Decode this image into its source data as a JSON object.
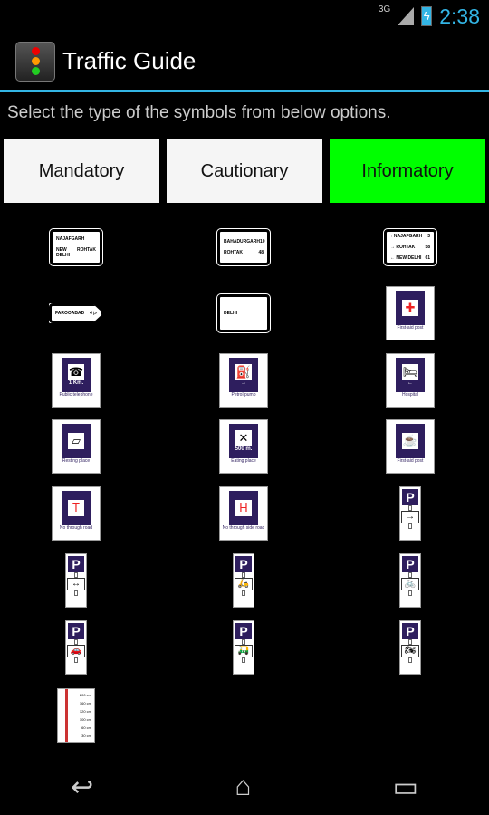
{
  "status": {
    "network": "3G",
    "time": "2:38"
  },
  "app": {
    "title": "Traffic Guide"
  },
  "prompt": "Select the type of the symbols from below options.",
  "categories": [
    {
      "label": "Mandatory",
      "selected": false
    },
    {
      "label": "Cautionary",
      "selected": false
    },
    {
      "label": "Informatory",
      "selected": true
    }
  ],
  "accent": "#33b5e5",
  "selected_color": "#00ff00",
  "signs": [
    {
      "type": "guide",
      "lines": [
        [
          "NAJAFGARH",
          ""
        ],
        [
          "NEW DELHI",
          "ROHTAK"
        ]
      ]
    },
    {
      "type": "guide",
      "lines": [
        [
          "BAHADURGARH",
          "10"
        ],
        [
          "ROHTAK",
          "48"
        ]
      ]
    },
    {
      "type": "guide",
      "lines": [
        [
          "↑ NAJAFGARH",
          "3"
        ],
        [
          "→ ROHTAK",
          "58"
        ],
        [
          "← NEW DELHI",
          "61"
        ]
      ]
    },
    {
      "type": "guide",
      "lines": [
        [
          "FAROOABAD",
          "4 ▷"
        ]
      ]
    },
    {
      "type": "guide",
      "lines": [
        [
          "DELHI",
          ""
        ]
      ]
    },
    {
      "type": "info",
      "icon": "first-aid-icon",
      "glyph": "✚",
      "caption": "First-aid post"
    },
    {
      "type": "info",
      "icon": "telephone-icon",
      "glyph": "☎",
      "sub": "1 Km.",
      "caption": "Public telephone"
    },
    {
      "type": "info",
      "icon": "petrol-pump-icon",
      "glyph": "⛽",
      "sub": "→",
      "caption": "Petrol pump"
    },
    {
      "type": "info",
      "icon": "hospital-icon",
      "glyph": "🛏",
      "sub": "←",
      "caption": "Hospital"
    },
    {
      "type": "info",
      "icon": "resting-place-icon",
      "glyph": "▱",
      "caption": "Resting place"
    },
    {
      "type": "info",
      "icon": "eating-place-icon",
      "glyph": "✕",
      "sub": "500 m.",
      "caption": "Eating place"
    },
    {
      "type": "info",
      "icon": "cup-icon",
      "glyph": "☕",
      "caption": "First-aid post"
    },
    {
      "type": "info",
      "icon": "no-through-road-icon",
      "glyph": "T",
      "caption": "No through road"
    },
    {
      "type": "info",
      "icon": "no-through-side-road-icon",
      "glyph": "H",
      "caption": "No through side road"
    },
    {
      "type": "park",
      "icon": "parking-right-arrow-icon",
      "glyph": "→"
    },
    {
      "type": "park",
      "icon": "parking-both-directions-icon",
      "glyph": "↔"
    },
    {
      "type": "park",
      "icon": "parking-scooter-icon",
      "glyph": "🛵"
    },
    {
      "type": "park",
      "icon": "parking-cycle-icon",
      "glyph": "🚲"
    },
    {
      "type": "park",
      "icon": "parking-car-icon",
      "glyph": "🚗"
    },
    {
      "type": "park",
      "icon": "parking-rickshaw-icon",
      "glyph": "🛺"
    },
    {
      "type": "park",
      "icon": "parking-motorcycle-icon",
      "glyph": "🏍"
    },
    {
      "type": "gauge",
      "marks": [
        "200 cm",
        "160 cm",
        "120 cm",
        "100 cm",
        "60 cm",
        "30 cm"
      ]
    }
  ]
}
